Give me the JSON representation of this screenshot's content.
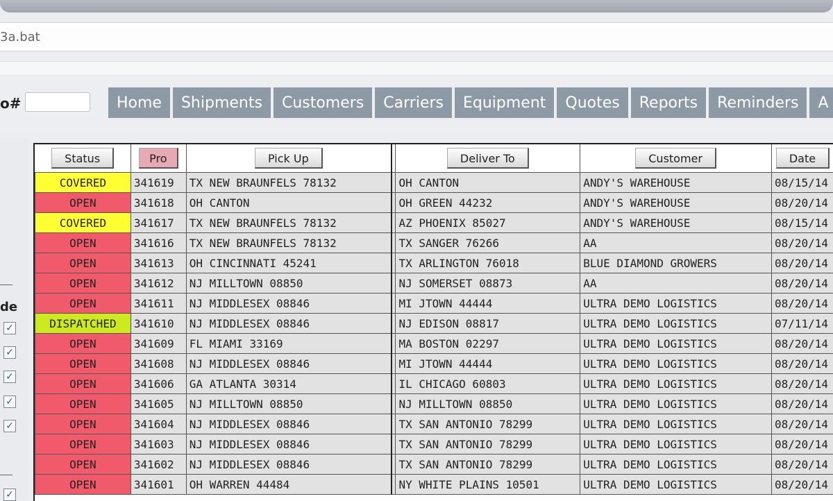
{
  "address_bar": {
    "text": "3a.bat"
  },
  "pro_search": {
    "label": "o#",
    "value": ""
  },
  "nav": {
    "tabs": [
      "Home",
      "Shipments",
      "Customers",
      "Carriers",
      "Equipment",
      "Quotes",
      "Reports",
      "Reminders",
      "A"
    ]
  },
  "side_panel": {
    "label": "de"
  },
  "table": {
    "headers": {
      "status": "Status",
      "pro": "Pro",
      "pickup": "Pick Up",
      "deliver": "Deliver To",
      "customer": "Customer",
      "date": "Date"
    },
    "rows": [
      {
        "status": "COVERED",
        "pro": "341619",
        "pickup": "TX NEW BRAUNFELS 78132",
        "deliver": "OH CANTON",
        "customer": "ANDY'S WAREHOUSE",
        "date": "08/15/14"
      },
      {
        "status": "OPEN",
        "pro": "341618",
        "pickup": "OH CANTON",
        "deliver": "OH GREEN 44232",
        "customer": "ANDY'S WAREHOUSE",
        "date": "08/20/14"
      },
      {
        "status": "COVERED",
        "pro": "341617",
        "pickup": "TX NEW BRAUNFELS 78132",
        "deliver": "AZ PHOENIX 85027",
        "customer": "ANDY'S WAREHOUSE",
        "date": "08/15/14"
      },
      {
        "status": "OPEN",
        "pro": "341616",
        "pickup": "TX NEW BRAUNFELS 78132",
        "deliver": "TX SANGER 76266",
        "customer": "AA",
        "date": "08/20/14"
      },
      {
        "status": "OPEN",
        "pro": "341613",
        "pickup": "OH CINCINNATI 45241",
        "deliver": "TX ARLINGTON 76018",
        "customer": "BLUE DIAMOND GROWERS",
        "date": "08/20/14"
      },
      {
        "status": "OPEN",
        "pro": "341612",
        "pickup": "NJ MILLTOWN 08850",
        "deliver": "NJ SOMERSET 08873",
        "customer": "AA",
        "date": "08/20/14"
      },
      {
        "status": "OPEN",
        "pro": "341611",
        "pickup": "NJ MIDDLESEX 08846",
        "deliver": "MI JTOWN 44444",
        "customer": "ULTRA DEMO LOGISTICS",
        "date": "08/20/14"
      },
      {
        "status": "DISPATCHED",
        "pro": "341610",
        "pickup": "NJ MIDDLESEX 08846",
        "deliver": "NJ EDISON 08817",
        "customer": "ULTRA DEMO LOGISTICS",
        "date": "07/11/14"
      },
      {
        "status": "OPEN",
        "pro": "341609",
        "pickup": "FL MIAMI 33169",
        "deliver": "MA BOSTON 02297",
        "customer": "ULTRA DEMO LOGISTICS",
        "date": "08/20/14"
      },
      {
        "status": "OPEN",
        "pro": "341608",
        "pickup": "NJ MIDDLESEX 08846",
        "deliver": "MI JTOWN 44444",
        "customer": "ULTRA DEMO LOGISTICS",
        "date": "08/20/14"
      },
      {
        "status": "OPEN",
        "pro": "341606",
        "pickup": "GA ATLANTA 30314",
        "deliver": "IL CHICAGO 60803",
        "customer": "ULTRA DEMO LOGISTICS",
        "date": "08/20/14"
      },
      {
        "status": "OPEN",
        "pro": "341605",
        "pickup": "NJ MILLTOWN 08850",
        "deliver": "NJ MILLTOWN 08850",
        "customer": "ULTRA DEMO LOGISTICS",
        "date": "08/20/14"
      },
      {
        "status": "OPEN",
        "pro": "341604",
        "pickup": "NJ MIDDLESEX 08846",
        "deliver": "TX SAN ANTONIO 78299",
        "customer": "ULTRA DEMO LOGISTICS",
        "date": "08/20/14"
      },
      {
        "status": "OPEN",
        "pro": "341603",
        "pickup": "NJ MIDDLESEX 08846",
        "deliver": "TX SAN ANTONIO 78299",
        "customer": "ULTRA DEMO LOGISTICS",
        "date": "08/20/14"
      },
      {
        "status": "OPEN",
        "pro": "341602",
        "pickup": "NJ MIDDLESEX 08846",
        "deliver": "TX SAN ANTONIO 78299",
        "customer": "ULTRA DEMO LOGISTICS",
        "date": "08/20/14"
      },
      {
        "status": "OPEN",
        "pro": "341601",
        "pickup": "OH WARREN 44484",
        "deliver": "NY WHITE PLAINS 10501",
        "customer": "ULTRA DEMO LOGISTICS",
        "date": "08/20/14"
      }
    ]
  },
  "status_colors": {
    "COVERED": "#ffff33",
    "OPEN": "#f05a6a",
    "DISPATCHED": "#ccea1f"
  },
  "nav_color": "#8e99a6",
  "icons": {
    "checkbox": "checkbox-checked-icon"
  }
}
